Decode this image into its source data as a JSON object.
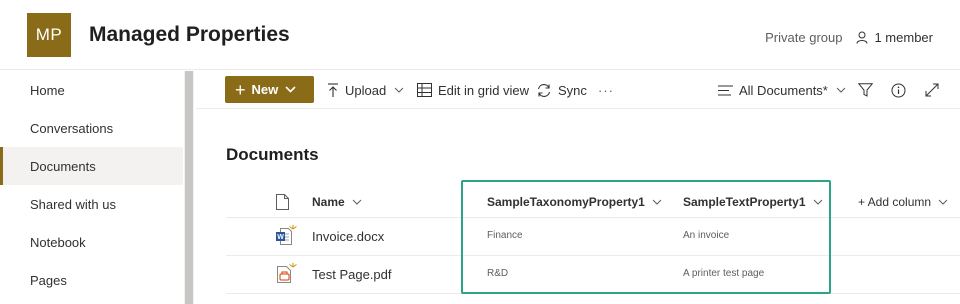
{
  "header": {
    "logo_initials": "MP",
    "title": "Managed Properties",
    "privacy": "Private group",
    "members": "1 member"
  },
  "nav": {
    "items": [
      {
        "label": "Home"
      },
      {
        "label": "Conversations"
      },
      {
        "label": "Documents",
        "selected": true
      },
      {
        "label": "Shared with us"
      },
      {
        "label": "Notebook"
      },
      {
        "label": "Pages"
      }
    ]
  },
  "commandbar": {
    "new_label": "New",
    "upload_label": "Upload",
    "grid_label": "Edit in grid view",
    "sync_label": "Sync",
    "more_label": "···",
    "view_label": "All Documents*"
  },
  "library": {
    "title": "Documents",
    "columns": {
      "name": "Name",
      "taxonomy": "SampleTaxonomyProperty1",
      "text": "SampleTextProperty1",
      "add": "+ Add column"
    },
    "rows": [
      {
        "name": "Invoice.docx",
        "taxonomy": "Finance",
        "text": "An invoice",
        "type": "word"
      },
      {
        "name": "Test Page.pdf",
        "taxonomy": "R&D",
        "text": "A printer test page",
        "type": "pdf"
      }
    ]
  },
  "colors": {
    "brand": "#8a6b17",
    "highlight": "#2aa386"
  }
}
